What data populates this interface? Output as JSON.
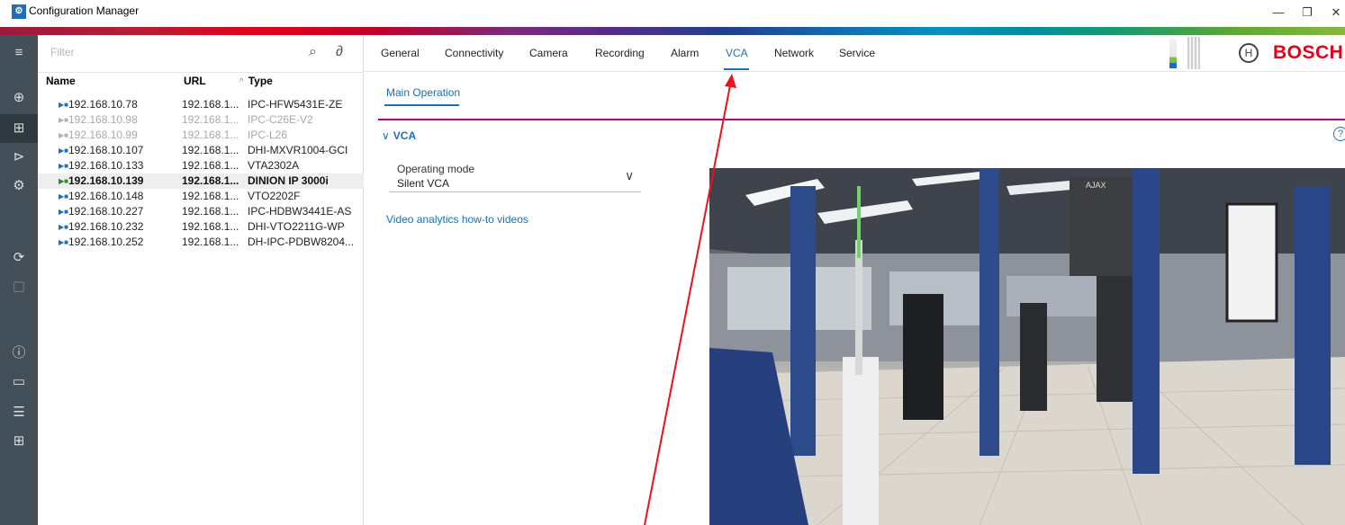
{
  "window": {
    "title": "Configuration Manager",
    "logo_glyph": "⚙",
    "minimize": "—",
    "restore": "❐",
    "close": "✕"
  },
  "rail": {
    "items": [
      {
        "name": "menu-icon",
        "glyph": "≡"
      },
      {
        "name": "globe-icon",
        "glyph": "⊕"
      },
      {
        "name": "devices-icon",
        "glyph": "⊞"
      },
      {
        "name": "camera-icon",
        "glyph": "⊳"
      },
      {
        "name": "gear-icon",
        "glyph": "⚙"
      },
      {
        "name": "refresh-icon",
        "glyph": "⟳"
      },
      {
        "name": "save-icon",
        "glyph": "▢"
      },
      {
        "name": "info-icon",
        "glyph": "ⓘ"
      },
      {
        "name": "video-icon",
        "glyph": "▭"
      },
      {
        "name": "storage-icon",
        "glyph": "☰"
      },
      {
        "name": "grid-icon",
        "glyph": "⊞"
      }
    ]
  },
  "tree": {
    "filter_placeholder": "Filter",
    "search_glyph": "⌕",
    "attach_glyph": "∂",
    "columns": {
      "name": "Name",
      "url": "URL",
      "type": "Type",
      "sort_glyph": "^"
    },
    "device_glyph": "▶■",
    "rows": [
      {
        "name": "192.168.10.78",
        "url": "192.168.1...",
        "type": "IPC-HFW5431E-ZE",
        "state": "normal"
      },
      {
        "name": "192.168.10.98",
        "url": "192.168.1...",
        "type": "IPC-C26E-V2",
        "state": "dim"
      },
      {
        "name": "192.168.10.99",
        "url": "192.168.1...",
        "type": "IPC-L26",
        "state": "dim"
      },
      {
        "name": "192.168.10.107",
        "url": "192.168.1...",
        "type": "DHI-MXVR1004-GCI",
        "state": "normal"
      },
      {
        "name": "192.168.10.133",
        "url": "192.168.1...",
        "type": "VTA2302A",
        "state": "normal"
      },
      {
        "name": "192.168.10.139",
        "url": "192.168.1...",
        "type": "DINION IP 3000i",
        "state": "selected"
      },
      {
        "name": "192.168.10.148",
        "url": "192.168.1...",
        "type": "VTO2202F",
        "state": "normal"
      },
      {
        "name": "192.168.10.227",
        "url": "192.168.1...",
        "type": "IPC-HDBW3441E-AS",
        "state": "normal"
      },
      {
        "name": "192.168.10.232",
        "url": "192.168.1...",
        "type": "DHI-VTO2211G-WP",
        "state": "normal"
      },
      {
        "name": "192.168.10.252",
        "url": "192.168.1...",
        "type": "DH-IPC-PDBW8204...",
        "state": "normal"
      }
    ]
  },
  "tabs": {
    "items": [
      "General",
      "Connectivity",
      "Camera",
      "Recording",
      "Alarm",
      "VCA",
      "Network",
      "Service"
    ],
    "active": "VCA"
  },
  "brand": {
    "mark": "H",
    "name": "BOSCH",
    "color": "#e2001a"
  },
  "main": {
    "subtab": "Main Operation",
    "section": {
      "chevron": "∨",
      "title": "VCA"
    },
    "help_glyph": "?",
    "operating_mode": {
      "label": "Operating mode",
      "value": "Silent VCA",
      "chevron": "∨"
    },
    "howto_link": "Video analytics how-to videos",
    "camera_overlay": "AJAX"
  },
  "colors": {
    "accent": "#1c6fb8",
    "section_line": "#b5007f",
    "annotation": "#e8141c"
  }
}
